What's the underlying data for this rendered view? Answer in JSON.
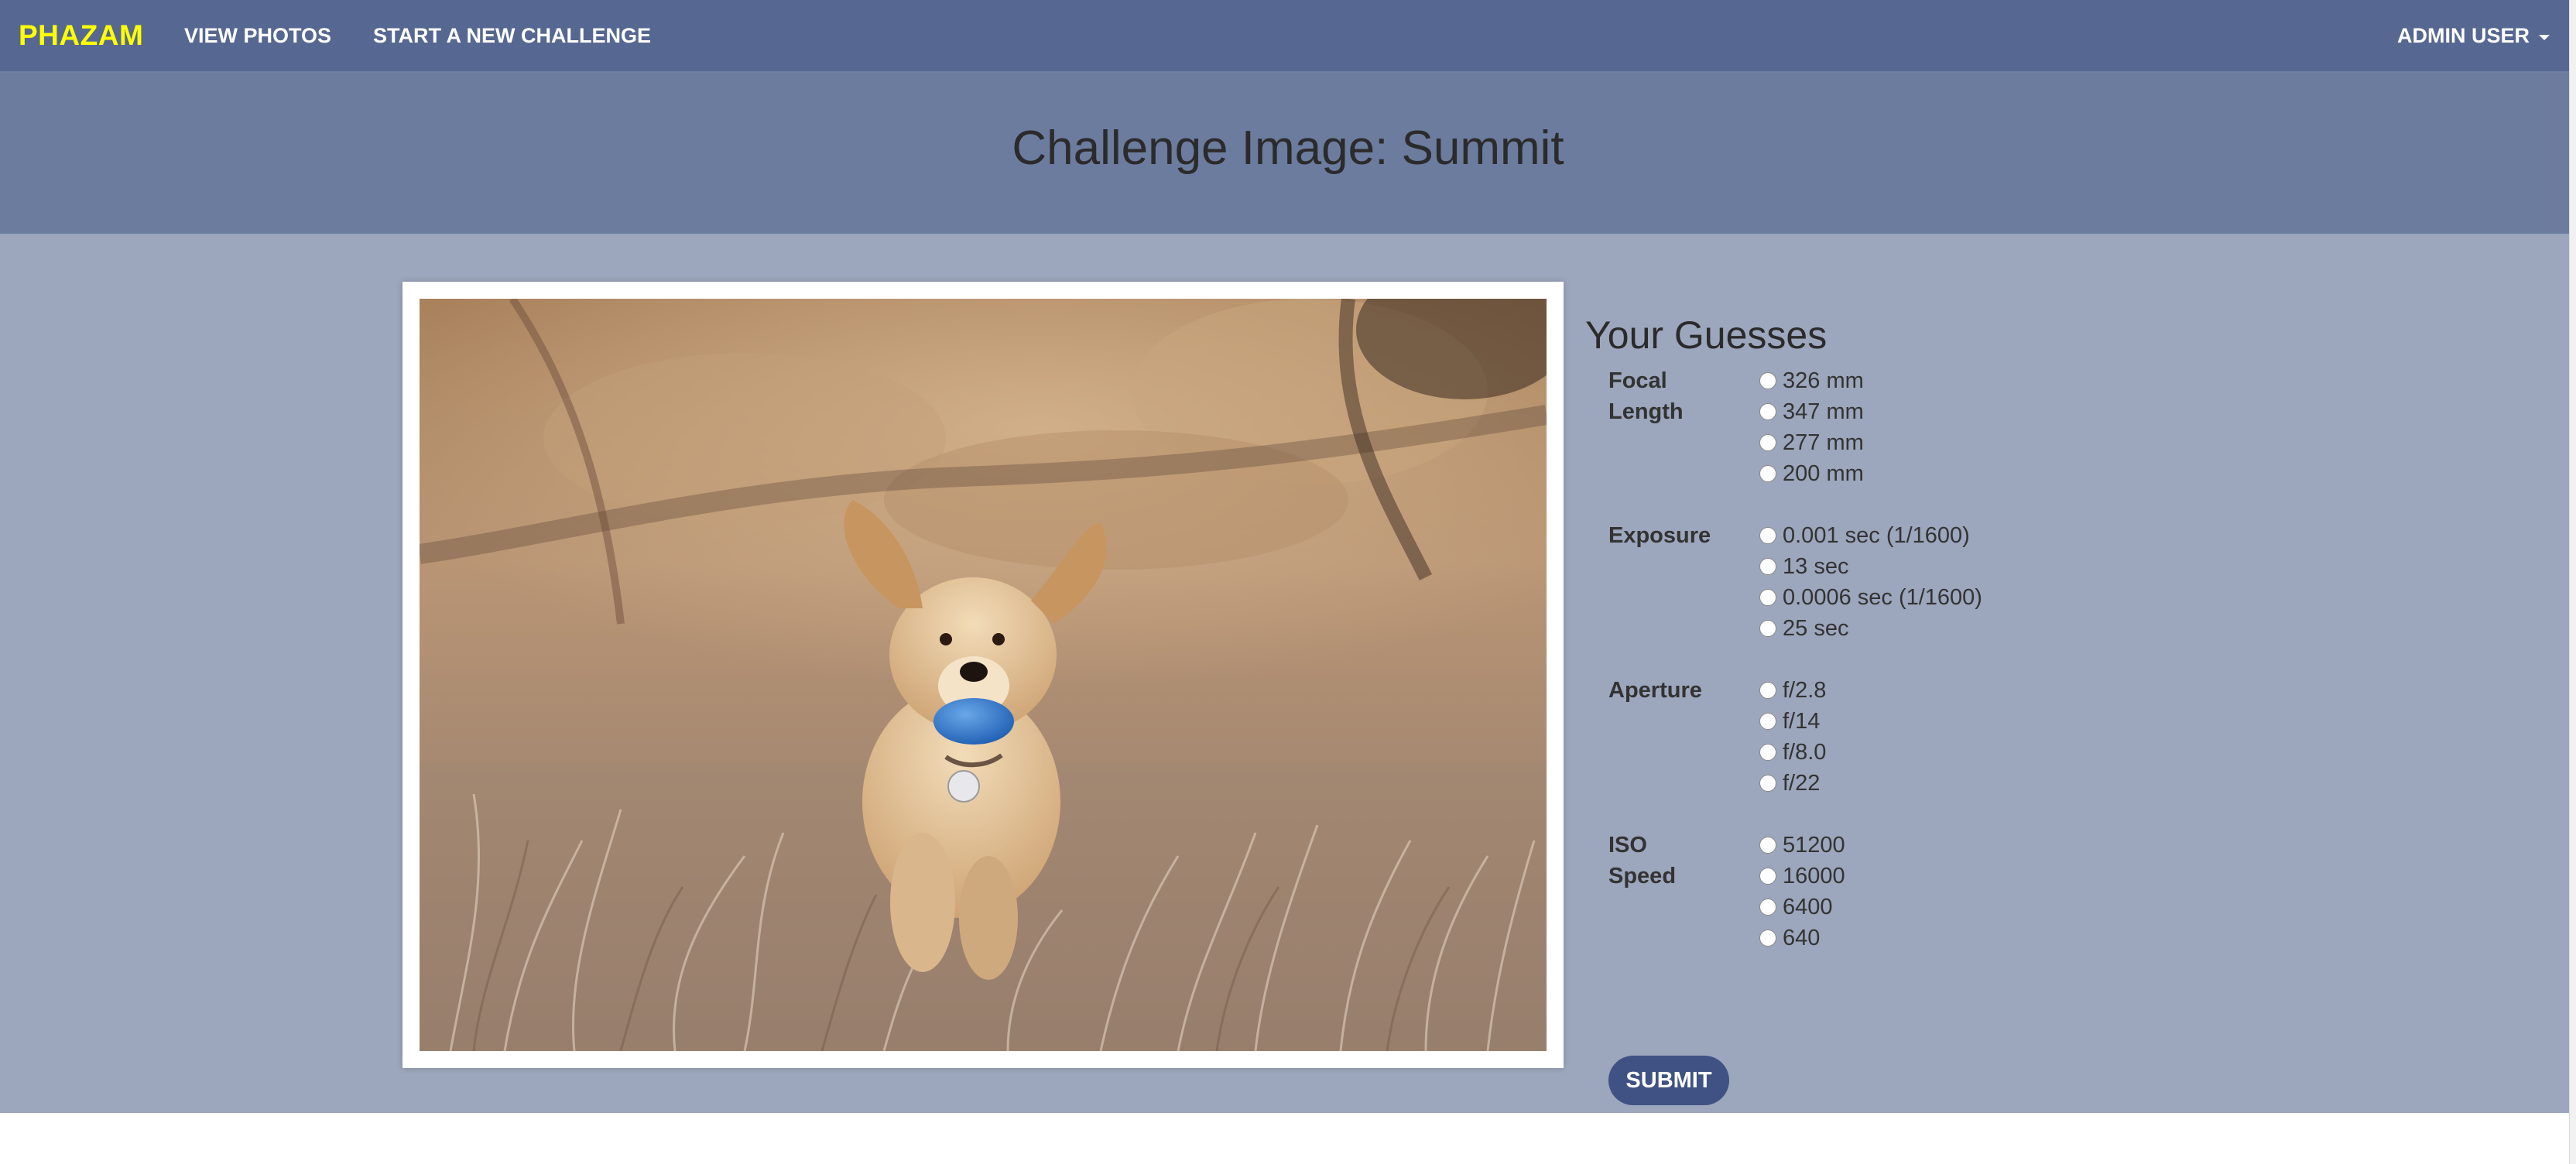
{
  "navbar": {
    "brand": "PHAZAM",
    "links": {
      "view_photos": "VIEW PHOTOS",
      "start_challenge": "START A NEW CHALLENGE"
    },
    "user": "ADMIN USER"
  },
  "header": {
    "title": "Challenge Image: Summit"
  },
  "photo": {
    "subject": "golden retriever puppy carrying blue ball in dry grass",
    "alt": "Challenge Image: Summit"
  },
  "guesses": {
    "title": "Your Guesses",
    "groups": [
      {
        "label_line1": "Focal",
        "label_line2": "Length",
        "options": [
          "326 mm",
          "347 mm",
          "277 mm",
          "200 mm"
        ]
      },
      {
        "label_line1": "Exposure",
        "label_line2": "",
        "options": [
          "0.001 sec (1/1600)",
          "13 sec",
          "0.0006 sec (1/1600)",
          "25 sec"
        ]
      },
      {
        "label_line1": "Aperture",
        "label_line2": "",
        "options": [
          "f/2.8",
          "f/14",
          "f/8.0",
          "f/22"
        ]
      },
      {
        "label_line1": "ISO",
        "label_line2": "Speed",
        "options": [
          "51200",
          "16000",
          "6400",
          "640"
        ]
      }
    ],
    "submit_label": "SUBMIT"
  },
  "colors": {
    "navbar": "#566891",
    "header_band": "#6c7c9f",
    "main_band": "#9ca6bc",
    "brand": "#ffff00",
    "submit_button": "#3f5283"
  }
}
